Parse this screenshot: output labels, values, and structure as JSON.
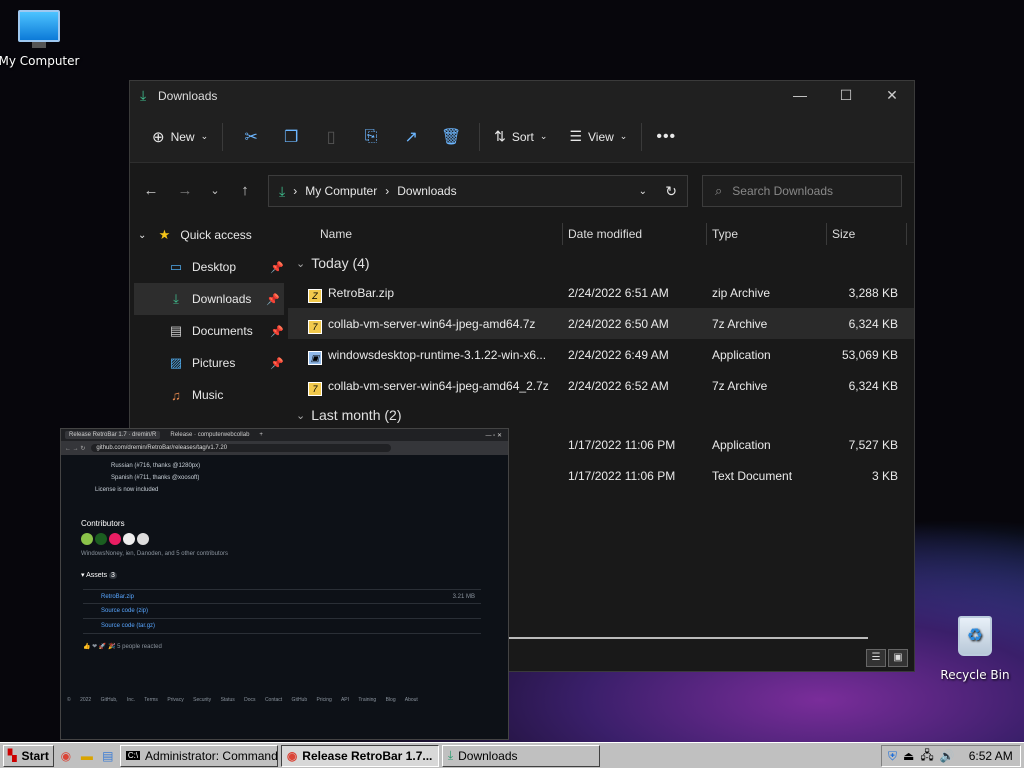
{
  "desktop": {
    "my_computer": "My Computer",
    "recycle_bin": "Recycle Bin"
  },
  "explorer": {
    "title": "Downloads",
    "commands": {
      "new": "New",
      "sort": "Sort",
      "view": "View"
    },
    "address": {
      "root": "My Computer",
      "current": "Downloads"
    },
    "search_placeholder": "Search Downloads",
    "sidebar": [
      {
        "label": "Quick access",
        "icon": "star-icon"
      },
      {
        "label": "Desktop",
        "icon": "desktop-folder-icon",
        "pinned": true
      },
      {
        "label": "Downloads",
        "icon": "download-icon",
        "pinned": true,
        "selected": true
      },
      {
        "label": "Documents",
        "icon": "documents-icon",
        "pinned": true
      },
      {
        "label": "Pictures",
        "icon": "pictures-icon",
        "pinned": true
      },
      {
        "label": "Music",
        "icon": "music-icon"
      }
    ],
    "columns": {
      "name": "Name",
      "date": "Date modified",
      "type": "Type",
      "size": "Size"
    },
    "groups": {
      "today": "Today (4)",
      "last_month": "Last month (2)"
    },
    "files": [
      {
        "name": "RetroBar.zip",
        "date": "2/24/2022 6:51 AM",
        "type": "zip Archive",
        "size": "3,288 KB"
      },
      {
        "name": "collab-vm-server-win64-jpeg-amd64.7z",
        "date": "2/24/2022 6:50 AM",
        "type": "7z Archive",
        "size": "6,324 KB"
      },
      {
        "name": "windowsdesktop-runtime-3.1.22-win-x6...",
        "date": "2/24/2022 6:49 AM",
        "type": "Application",
        "size": "53,069 KB"
      },
      {
        "name": "collab-vm-server-win64-jpeg-amd64_2.7z",
        "date": "2/24/2022 6:52 AM",
        "type": "7z Archive",
        "size": "6,324 KB"
      },
      {
        "name": "",
        "date": "1/17/2022 11:06 PM",
        "type": "Application",
        "size": "7,527 KB"
      },
      {
        "name": "",
        "date": "1/17/2022 11:06 PM",
        "type": "Text Document",
        "size": "3 KB"
      }
    ]
  },
  "browser": {
    "tab1": "Release RetroBar 1.7 · dremin/R",
    "tab2": "Release · computerwebcollab",
    "url": "github.com/dremin/RetroBar/releases/tag/v1.7.20",
    "lines": [
      "Russian (#716, thanks @1280px)",
      "Spanish (#711, thanks @xoosoft)",
      "License is now included"
    ],
    "contributors_title": "Contributors",
    "contributors_text": "WindowsNoney, ien, Danoden, and 5 other contributors",
    "assets_title": "Assets",
    "assets_count": "3",
    "assets": [
      {
        "name": "RetroBar.zip",
        "size": "3.21 MB"
      },
      {
        "name": "Source code (zip)",
        "size": ""
      },
      {
        "name": "Source code (tar.gz)",
        "size": ""
      }
    ],
    "reactions": "5 people reacted",
    "footer": [
      "© 2022 GitHub, Inc.",
      "Terms",
      "Privacy",
      "Security",
      "Status",
      "Docs",
      "Contact GitHub",
      "Pricing",
      "API",
      "Training",
      "Blog",
      "About"
    ]
  },
  "taskbar": {
    "start": "Start",
    "items": [
      {
        "label": "Administrator: Command P..."
      },
      {
        "label": "Release RetroBar 1.7..."
      },
      {
        "label": "Downloads"
      }
    ],
    "clock": "6:52 AM"
  }
}
